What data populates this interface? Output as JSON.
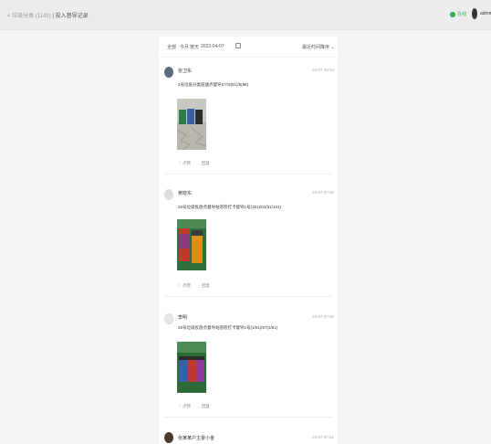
{
  "header": {
    "back_label": "< 垃圾分类 (1143)",
    "page_title": "| 投入督导记录",
    "status": "在线",
    "user": "admin"
  },
  "filters": {
    "all": "全部",
    "this_month": "今月",
    "pick_day": "按天",
    "date": "2022-04-07",
    "sort": "最近时间降序"
  },
  "posts": [
    {
      "author": "张卫东",
      "time": "04-07 09:44",
      "content": "2号垃圾分类投放点督导1/7/2(51)/6(56)",
      "likes": "点赞",
      "comments": "回复",
      "avatar_color": "#5a6a7a"
    },
    {
      "author": "黄晓东",
      "time": "04-07 07:59",
      "content": "26号垃圾投放点督导站巡检打卡督导1号(151)/01(51/151)",
      "likes": "点赞",
      "comments": "回复",
      "avatar_color": "#dcdcdc"
    },
    {
      "author": "李明",
      "time": "04-07 07:58",
      "content": "26号垃圾投放点督导站巡检打卡督导1号(1/61)/67(1/51)",
      "likes": "点赞",
      "comments": "回复",
      "avatar_color": "#e8e8e8"
    },
    {
      "author": "张某某户主督小金",
      "time": "04-07 07:51",
      "content": "",
      "likes": "",
      "comments": "",
      "avatar_color": "#4a3a30"
    }
  ],
  "colors": {
    "accent_green": "#2bb24c",
    "background": "#f3f3f3",
    "panel": "#ffffff"
  }
}
